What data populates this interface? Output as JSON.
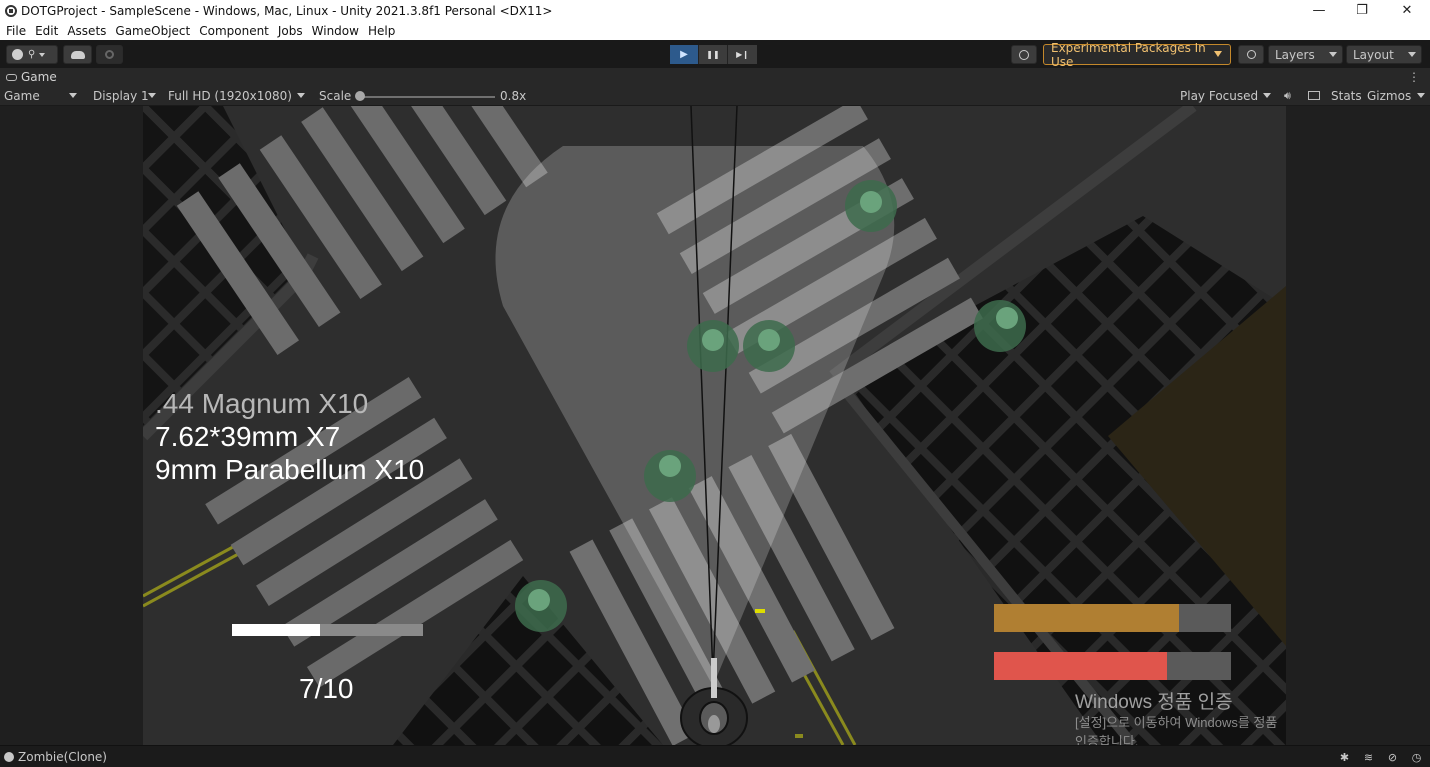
{
  "window": {
    "title": "DOTGProject - SampleScene - Windows, Mac, Linux - Unity 2021.3.8f1 Personal <DX11>",
    "controls": [
      "—",
      "❐",
      "✕"
    ]
  },
  "menu": [
    "File",
    "Edit",
    "Assets",
    "GameObject",
    "Component",
    "Jobs",
    "Window",
    "Help"
  ],
  "toolbar": {
    "play_icon": "▶",
    "pause_icon": "❚❚",
    "step_icon": "▶❙",
    "experimental_label": "Experimental Packages In Use",
    "layers_label": "Layers",
    "layout_label": "Layout"
  },
  "tab": {
    "label": "Game",
    "menu_icon": "⋮"
  },
  "game_bar": {
    "view_select": "Game",
    "display_select": "Display 1",
    "resolution_select": "Full HD (1920x1080)",
    "scale_label": "Scale",
    "scale_value": "0.8x",
    "play_mode_select": "Play Focused",
    "stats_label": "Stats",
    "gizmos_label": "Gizmos"
  },
  "hud": {
    "ammo": [
      ".44 Magnum X10",
      "7.62*39mm X7",
      "9mm Parabellum X10"
    ],
    "magazine": "7/10",
    "reload_fraction": 0.46,
    "stamina_fraction": 0.78,
    "health_fraction": 0.73,
    "stamina_color": "#b07f32",
    "health_color": "#e0554c",
    "windows_activation_title": "Windows 정품 인증",
    "windows_activation_text": "[설정]으로 이동하여 Windows를 정품 인증합니다."
  },
  "status": {
    "text": "Zombie(Clone)"
  },
  "colors": {
    "accent_play": "#2d5a8c",
    "experimental_border": "#c4882b"
  }
}
